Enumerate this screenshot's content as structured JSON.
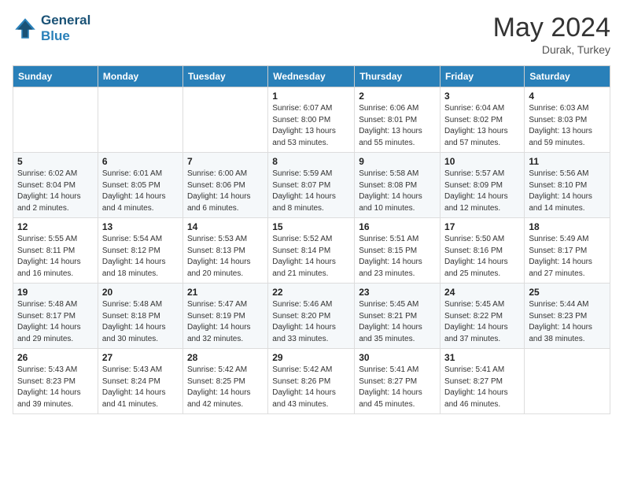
{
  "header": {
    "logo_line1": "General",
    "logo_line2": "Blue",
    "month_title": "May 2024",
    "subtitle": "Durak, Turkey"
  },
  "weekdays": [
    "Sunday",
    "Monday",
    "Tuesday",
    "Wednesday",
    "Thursday",
    "Friday",
    "Saturday"
  ],
  "weeks": [
    [
      {
        "day": "",
        "info": ""
      },
      {
        "day": "",
        "info": ""
      },
      {
        "day": "",
        "info": ""
      },
      {
        "day": "1",
        "info": "Sunrise: 6:07 AM\nSunset: 8:00 PM\nDaylight: 13 hours\nand 53 minutes."
      },
      {
        "day": "2",
        "info": "Sunrise: 6:06 AM\nSunset: 8:01 PM\nDaylight: 13 hours\nand 55 minutes."
      },
      {
        "day": "3",
        "info": "Sunrise: 6:04 AM\nSunset: 8:02 PM\nDaylight: 13 hours\nand 57 minutes."
      },
      {
        "day": "4",
        "info": "Sunrise: 6:03 AM\nSunset: 8:03 PM\nDaylight: 13 hours\nand 59 minutes."
      }
    ],
    [
      {
        "day": "5",
        "info": "Sunrise: 6:02 AM\nSunset: 8:04 PM\nDaylight: 14 hours\nand 2 minutes."
      },
      {
        "day": "6",
        "info": "Sunrise: 6:01 AM\nSunset: 8:05 PM\nDaylight: 14 hours\nand 4 minutes."
      },
      {
        "day": "7",
        "info": "Sunrise: 6:00 AM\nSunset: 8:06 PM\nDaylight: 14 hours\nand 6 minutes."
      },
      {
        "day": "8",
        "info": "Sunrise: 5:59 AM\nSunset: 8:07 PM\nDaylight: 14 hours\nand 8 minutes."
      },
      {
        "day": "9",
        "info": "Sunrise: 5:58 AM\nSunset: 8:08 PM\nDaylight: 14 hours\nand 10 minutes."
      },
      {
        "day": "10",
        "info": "Sunrise: 5:57 AM\nSunset: 8:09 PM\nDaylight: 14 hours\nand 12 minutes."
      },
      {
        "day": "11",
        "info": "Sunrise: 5:56 AM\nSunset: 8:10 PM\nDaylight: 14 hours\nand 14 minutes."
      }
    ],
    [
      {
        "day": "12",
        "info": "Sunrise: 5:55 AM\nSunset: 8:11 PM\nDaylight: 14 hours\nand 16 minutes."
      },
      {
        "day": "13",
        "info": "Sunrise: 5:54 AM\nSunset: 8:12 PM\nDaylight: 14 hours\nand 18 minutes."
      },
      {
        "day": "14",
        "info": "Sunrise: 5:53 AM\nSunset: 8:13 PM\nDaylight: 14 hours\nand 20 minutes."
      },
      {
        "day": "15",
        "info": "Sunrise: 5:52 AM\nSunset: 8:14 PM\nDaylight: 14 hours\nand 21 minutes."
      },
      {
        "day": "16",
        "info": "Sunrise: 5:51 AM\nSunset: 8:15 PM\nDaylight: 14 hours\nand 23 minutes."
      },
      {
        "day": "17",
        "info": "Sunrise: 5:50 AM\nSunset: 8:16 PM\nDaylight: 14 hours\nand 25 minutes."
      },
      {
        "day": "18",
        "info": "Sunrise: 5:49 AM\nSunset: 8:17 PM\nDaylight: 14 hours\nand 27 minutes."
      }
    ],
    [
      {
        "day": "19",
        "info": "Sunrise: 5:48 AM\nSunset: 8:17 PM\nDaylight: 14 hours\nand 29 minutes."
      },
      {
        "day": "20",
        "info": "Sunrise: 5:48 AM\nSunset: 8:18 PM\nDaylight: 14 hours\nand 30 minutes."
      },
      {
        "day": "21",
        "info": "Sunrise: 5:47 AM\nSunset: 8:19 PM\nDaylight: 14 hours\nand 32 minutes."
      },
      {
        "day": "22",
        "info": "Sunrise: 5:46 AM\nSunset: 8:20 PM\nDaylight: 14 hours\nand 33 minutes."
      },
      {
        "day": "23",
        "info": "Sunrise: 5:45 AM\nSunset: 8:21 PM\nDaylight: 14 hours\nand 35 minutes."
      },
      {
        "day": "24",
        "info": "Sunrise: 5:45 AM\nSunset: 8:22 PM\nDaylight: 14 hours\nand 37 minutes."
      },
      {
        "day": "25",
        "info": "Sunrise: 5:44 AM\nSunset: 8:23 PM\nDaylight: 14 hours\nand 38 minutes."
      }
    ],
    [
      {
        "day": "26",
        "info": "Sunrise: 5:43 AM\nSunset: 8:23 PM\nDaylight: 14 hours\nand 39 minutes."
      },
      {
        "day": "27",
        "info": "Sunrise: 5:43 AM\nSunset: 8:24 PM\nDaylight: 14 hours\nand 41 minutes."
      },
      {
        "day": "28",
        "info": "Sunrise: 5:42 AM\nSunset: 8:25 PM\nDaylight: 14 hours\nand 42 minutes."
      },
      {
        "day": "29",
        "info": "Sunrise: 5:42 AM\nSunset: 8:26 PM\nDaylight: 14 hours\nand 43 minutes."
      },
      {
        "day": "30",
        "info": "Sunrise: 5:41 AM\nSunset: 8:27 PM\nDaylight: 14 hours\nand 45 minutes."
      },
      {
        "day": "31",
        "info": "Sunrise: 5:41 AM\nSunset: 8:27 PM\nDaylight: 14 hours\nand 46 minutes."
      },
      {
        "day": "",
        "info": ""
      }
    ]
  ]
}
